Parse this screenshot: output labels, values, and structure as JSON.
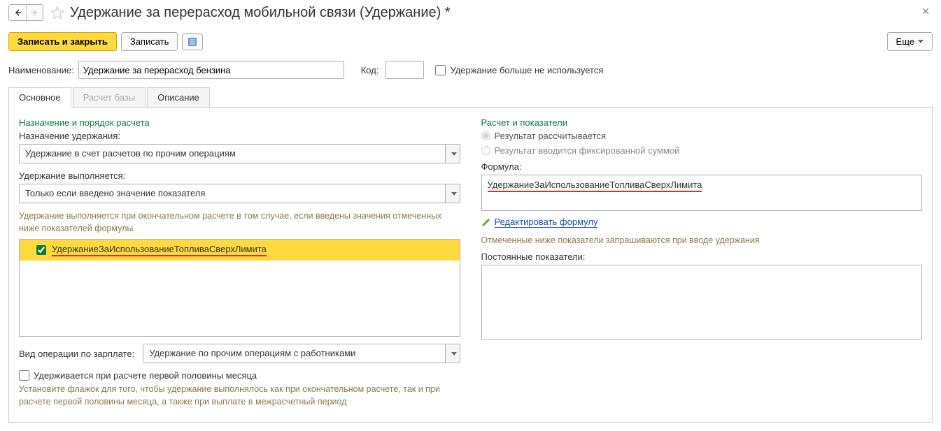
{
  "title": "Удержание за перерасход мобильной связи (Удержание) *",
  "toolbar": {
    "save_close": "Записать и закрыть",
    "save": "Записать",
    "more": "Еще"
  },
  "fields": {
    "name_label": "Наименование:",
    "name_value": "Удержание за перерасход бензина",
    "code_label": "Код:",
    "code_value": "",
    "not_used_label": "Удержание больше не используется"
  },
  "tabs": {
    "main": "Основное",
    "base_calc": "Расчет базы",
    "description": "Описание"
  },
  "left": {
    "section": "Назначение и порядок расчета",
    "purpose_label": "Назначение удержания:",
    "purpose_value": "Удержание в счет расчетов по прочим операциям",
    "when_label": "Удержание выполняется:",
    "when_value": "Только если введено значение показателя",
    "hint": "Удержание выполняется при окончательном расчете в том случае, если введены значения отмеченных ниже показателей формулы",
    "indicator": "УдержаниеЗаИспользованиеТопливаСверхЛимита",
    "op_label": "Вид операции по зарплате:",
    "op_value": "Удержание по прочим операциям с работниками",
    "first_half_label": "Удерживается при расчете первой половины месяца",
    "first_half_hint": "Установите флажок для того, чтобы удержание выполнялось как при окончательном расчете, так и при расчете первой половины месяца, а также при выплате в межрасчетный период"
  },
  "right": {
    "section": "Расчет и показатели",
    "radio_calc": "Результат рассчитывается",
    "radio_fixed": "Результат вводится фиксированной суммой",
    "formula_label": "Формула:",
    "formula_value": "УдержаниеЗаИспользованиеТопливаСверхЛимита",
    "edit_formula": "Редактировать формулу",
    "hint": "Отмеченные ниже показатели запрашиваются при вводе удержания",
    "const_label": "Постоянные показатели:"
  }
}
